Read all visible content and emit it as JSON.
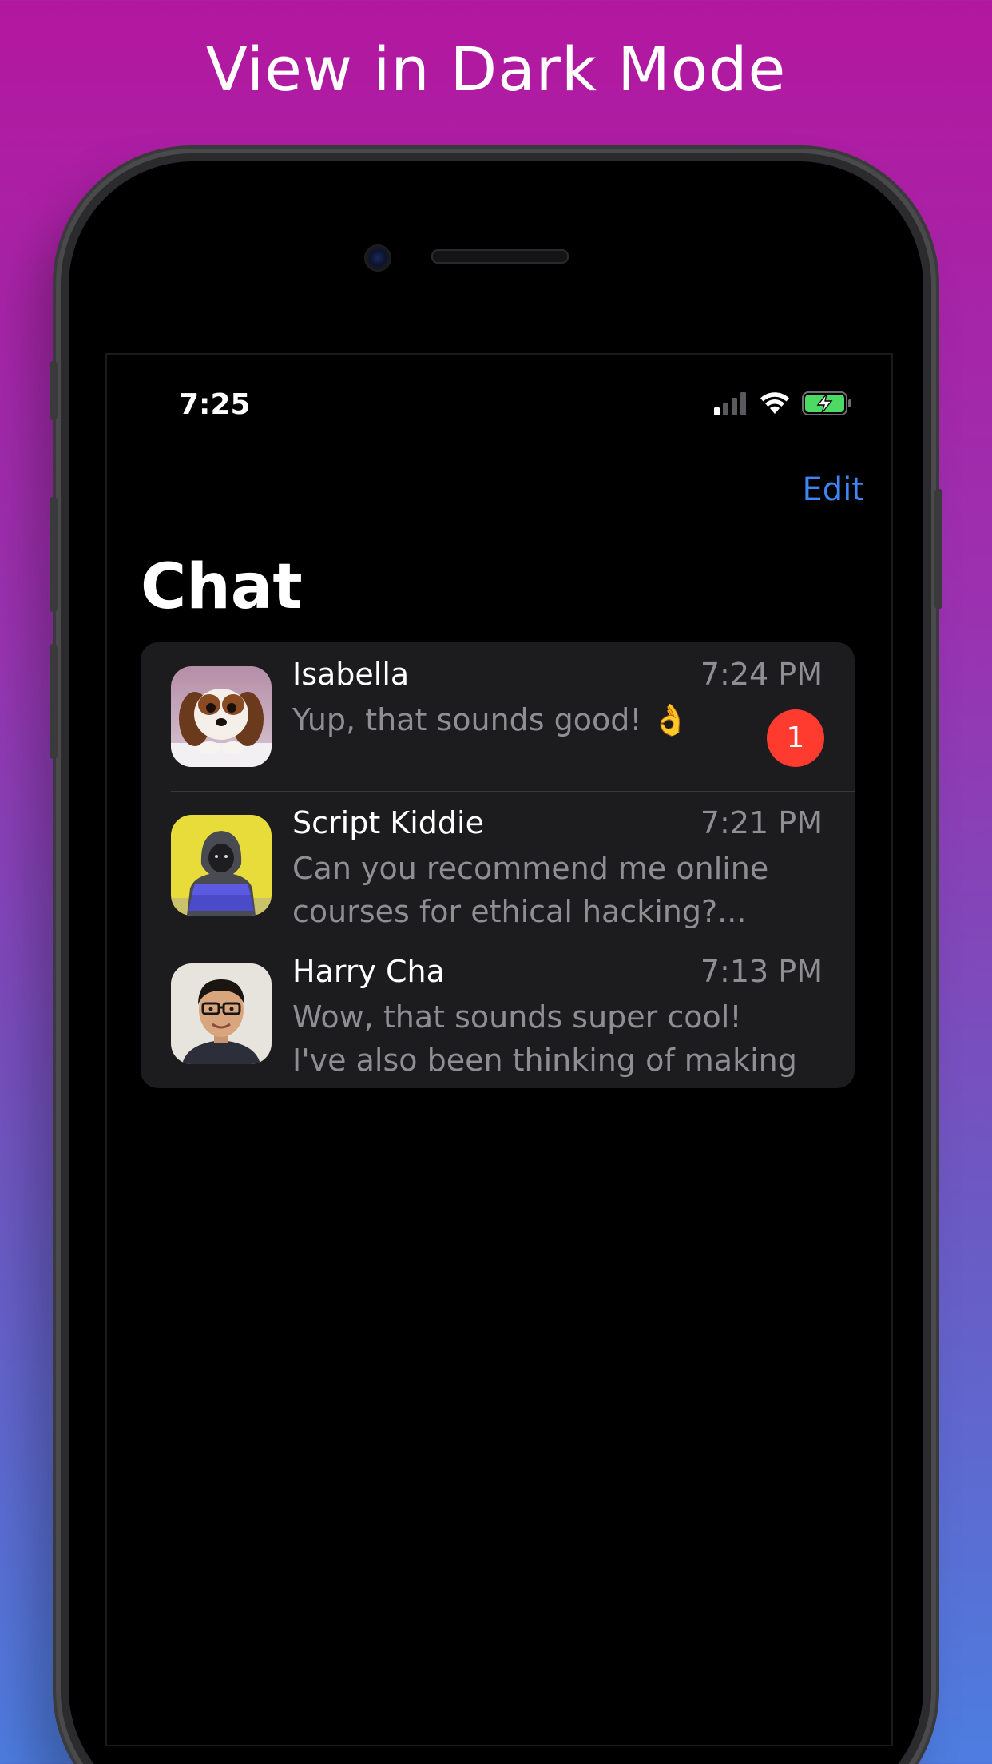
{
  "banner": {
    "title": "View in Dark Mode"
  },
  "status_bar": {
    "time": "7:25",
    "icons": [
      "cellular-signal-icon",
      "wifi-icon",
      "battery-charging-icon"
    ],
    "battery_color": "#4cd964"
  },
  "nav": {
    "edit_label": "Edit"
  },
  "page": {
    "title": "Chat"
  },
  "colors": {
    "accent": "#3e86f5",
    "badge": "#ff3b30",
    "card": "#1c1c1e",
    "secondary_text": "#8e8e93"
  },
  "chats": [
    {
      "name": "Isabella",
      "time": "7:24 PM",
      "preview": "Yup, that sounds good! 👌",
      "unread": "1",
      "avatar": "puppy-avatar"
    },
    {
      "name": "Script Kiddie",
      "time": "7:21 PM",
      "preview": "Can you recommend me online courses for ethical hacking?...",
      "avatar": "hooded-hacker-avatar"
    },
    {
      "name": "Harry Cha",
      "time": "7:13 PM",
      "preview": "Wow, that sounds super cool! I've also been thinking of making pr...",
      "avatar": "person-avatar"
    }
  ]
}
